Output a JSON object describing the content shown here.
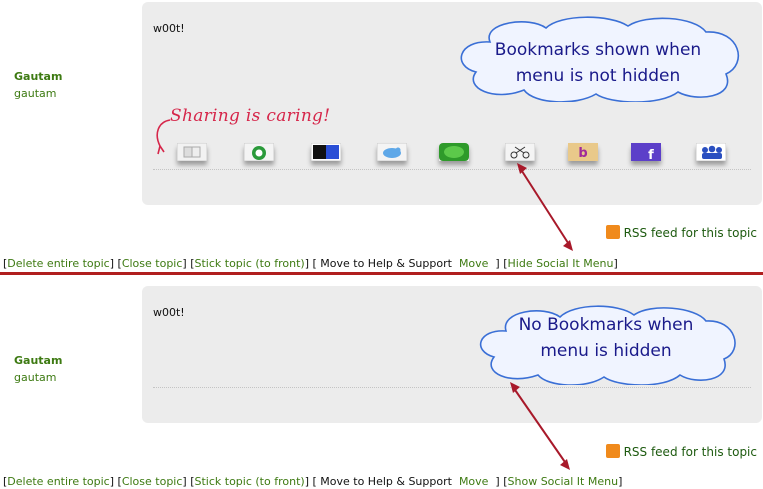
{
  "colors": {
    "link_green": "#3d7a12",
    "divider_red": "#b01e1e",
    "callout_text": "#1a1a8a",
    "callout_fill": "#f0f4ff",
    "callout_border": "#3a6fd6",
    "arrow_red": "#a8192a",
    "rss_orange": "#f08a1c",
    "sharing_pink": "#d6264a"
  },
  "top": {
    "author": {
      "display_name": "Gautam",
      "username": "gautam"
    },
    "post": {
      "text": "w00t!"
    },
    "sharing_label": "Sharing is caring!",
    "callout": {
      "line1": "Bookmarks shown when",
      "line2": "menu is not hidden"
    },
    "bookmark_icons": [
      "delicious-icon",
      "stumbleupon-icon",
      "delicious-blue-icon",
      "twitter-bird-icon",
      "green-pill-icon",
      "scissors-icon",
      "bebo-icon",
      "facebook-icon",
      "myspace-icon"
    ],
    "rss": {
      "label": "RSS feed for this topic"
    },
    "actions": {
      "delete_label": "Delete entire topic",
      "close_label": "Close topic",
      "stick_label": "Stick topic (to front)",
      "move_prefix": "Move to Help & Support",
      "move_label": "Move",
      "menu_toggle_label": "Hide Social It Menu"
    }
  },
  "bottom": {
    "author": {
      "display_name": "Gautam",
      "username": "gautam"
    },
    "post": {
      "text": "w00t!"
    },
    "callout": {
      "line1": "No Bookmarks when",
      "line2": "menu is hidden"
    },
    "rss": {
      "label": "RSS feed for this topic"
    },
    "actions": {
      "delete_label": "Delete entire topic",
      "close_label": "Close topic",
      "stick_label": "Stick topic (to front)",
      "move_prefix": "Move to Help & Support",
      "move_label": "Move",
      "menu_toggle_label": "Show Social It Menu"
    }
  }
}
